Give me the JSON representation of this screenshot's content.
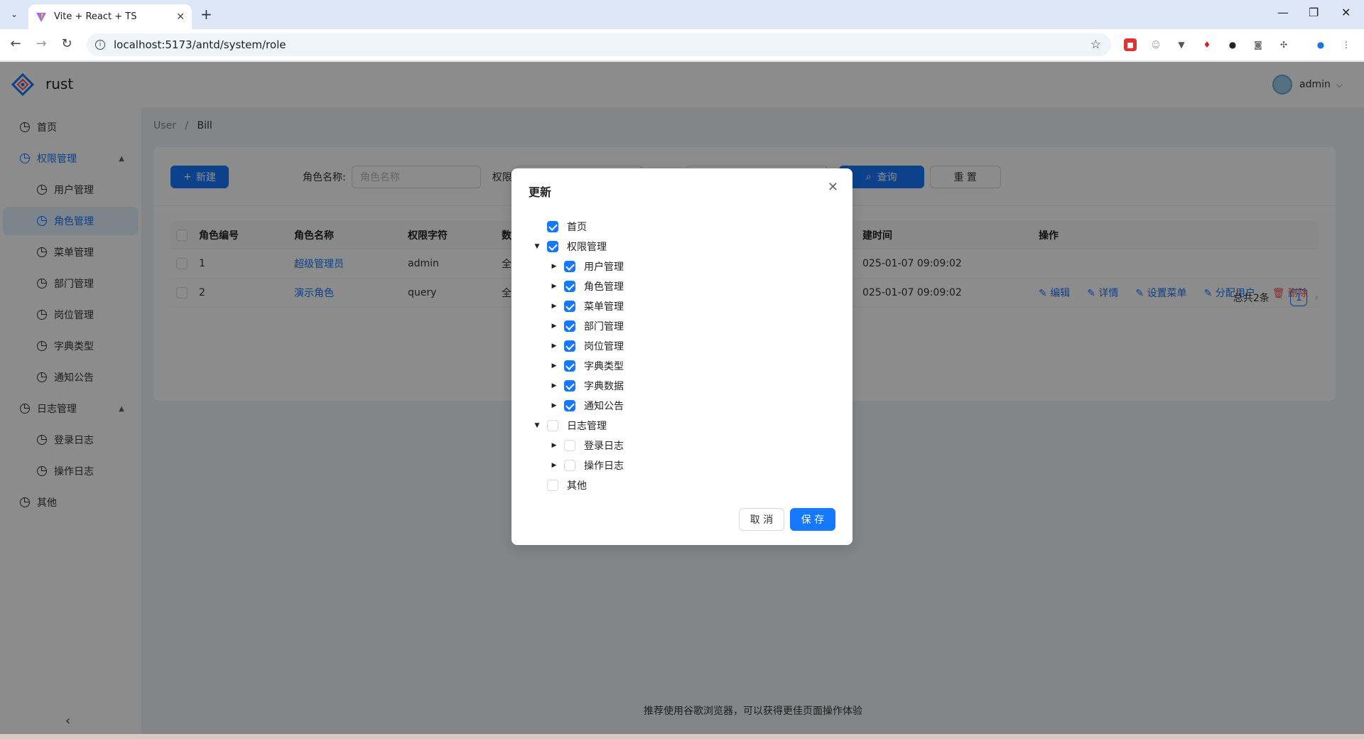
{
  "browser": {
    "tab_title": "Vite + React + TS",
    "url": "localhost:5173/antd/system/role",
    "new_tab": "+",
    "close_tab": "✕"
  },
  "app": {
    "brand": "rust",
    "user_name": "admin"
  },
  "sidebar": {
    "items": [
      {
        "label": "首页"
      },
      {
        "label": "权限管理"
      },
      {
        "label": "用户管理"
      },
      {
        "label": "角色管理"
      },
      {
        "label": "菜单管理"
      },
      {
        "label": "部门管理"
      },
      {
        "label": "岗位管理"
      },
      {
        "label": "字典类型"
      },
      {
        "label": "通知公告"
      },
      {
        "label": "日志管理"
      },
      {
        "label": "登录日志"
      },
      {
        "label": "操作日志"
      },
      {
        "label": "其他"
      }
    ]
  },
  "breadcrumb": {
    "root": "User",
    "sep": "/",
    "current": "Bill"
  },
  "toolbar": {
    "new_label": "新建",
    "role_name_label": "角色名称:",
    "role_name_placeholder": "角色名称",
    "perm_label": "权限",
    "query_label": "查询",
    "reset_label": "重 置"
  },
  "table": {
    "headers": [
      "角色编号",
      "角色名称",
      "权限字符",
      "数",
      "建时间",
      "操作"
    ],
    "rows": [
      {
        "id": "1",
        "name": "超级管理员",
        "key": "admin",
        "scope": "全",
        "time": "025-01-07 09:09:02"
      },
      {
        "id": "2",
        "name": "演示角色",
        "key": "query",
        "scope": "全",
        "time": "025-01-07 09:09:02"
      }
    ],
    "actions": {
      "edit": "编辑",
      "detail": "详情",
      "set_menu": "设置菜单",
      "assign_user": "分配用户",
      "delete": "删除"
    }
  },
  "pagination": {
    "total": "总共2条",
    "page": "1"
  },
  "footer": "推荐使用谷歌浏览器，可以获得更佳页面操作体验",
  "modal": {
    "title": "更新",
    "tree": [
      {
        "label": "首页",
        "checked": true
      },
      {
        "label": "权限管理",
        "checked": true
      },
      {
        "label": "用户管理",
        "checked": true
      },
      {
        "label": "角色管理",
        "checked": true
      },
      {
        "label": "菜单管理",
        "checked": true
      },
      {
        "label": "部门管理",
        "checked": true
      },
      {
        "label": "岗位管理",
        "checked": true
      },
      {
        "label": "字典类型",
        "checked": true
      },
      {
        "label": "字典数据",
        "checked": true
      },
      {
        "label": "通知公告",
        "checked": true
      },
      {
        "label": "日志管理",
        "checked": false
      },
      {
        "label": "登录日志",
        "checked": false
      },
      {
        "label": "操作日志",
        "checked": false
      },
      {
        "label": "其他",
        "checked": false
      }
    ],
    "cancel_label": "取 消",
    "save_label": "保 存"
  },
  "colors": {
    "primary": "#1677ff",
    "danger": "#ff4d4f",
    "mask": "rgba(0,0,0,0.45)"
  }
}
